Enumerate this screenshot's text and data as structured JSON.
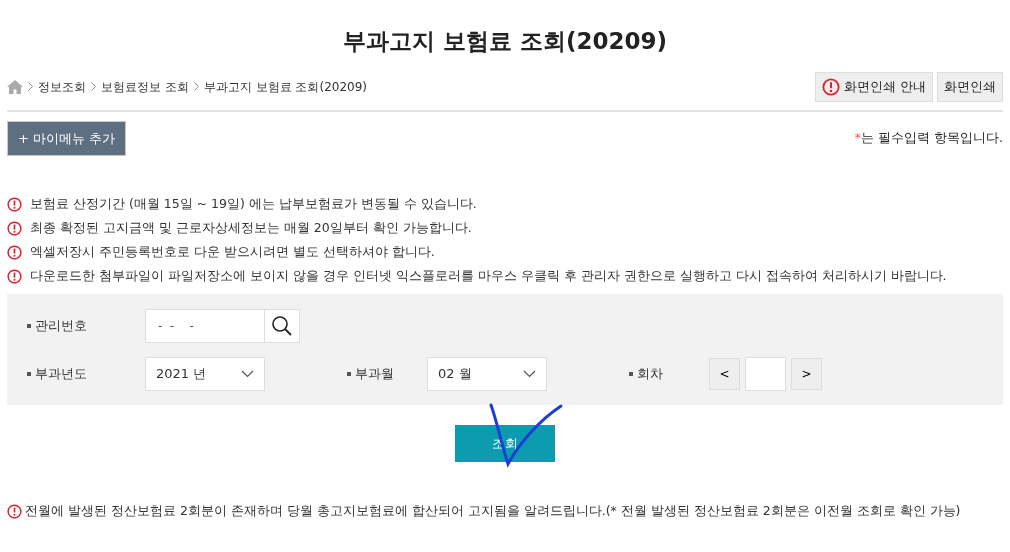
{
  "title": "부과고지 보험료 조회(20209)",
  "breadcrumb": [
    "정보조회",
    "보험료정보 조회",
    "부과고지 보험료 조회(20209)"
  ],
  "header_buttons": [
    {
      "label": "화면인쇄 안내",
      "kind": "info"
    },
    {
      "label": "화면인쇄",
      "kind": "plain"
    }
  ],
  "mymenu_button": {
    "icon": "+",
    "label": "마이메뉴 추가"
  },
  "required_note": {
    "mark": "*",
    "text": "는 필수입력 항목입니다."
  },
  "notices": [
    "보험료 산정기간 (매월 15일 ~ 19일) 에는 납부보험료가 변동될 수 있습니다.",
    "최종 확정된 고지금액 및 근로자상세정보는 매월 20일부터 확인 가능합니다.",
    "엑셀저장시 주민등록번호로 다운 받으시려면 별도 선택하셔야 합니다.",
    "다운로드한 첨부파일이 파일저장소에 보이지 않을 경우 인터넷 익스플로러를 마우스 우클릭 후 관리자 권한으로 실행하고 다시 접속하여 처리하시기 바랍니다."
  ],
  "form_rows": [
    [
      {
        "kind": "search",
        "label": "관리번호",
        "value": "-  -    -"
      }
    ],
    [
      {
        "kind": "select",
        "label": "부과년도",
        "value": "2021 년"
      },
      {
        "kind": "select",
        "label": "부과월",
        "value": "02 월"
      },
      {
        "kind": "stepper",
        "label": "회차",
        "prev": "<",
        "next": ">"
      }
    ]
  ],
  "submit_button": "조회",
  "footer_notice": "전월에 발생된 정산보험료 2회분이 존재하며 당월 총고지보험료에 합산되어 고지됨을 알려드립니다.(* 전월 발생된 정산보험료 2회분은 이전월 조회로 확인 가능)"
}
